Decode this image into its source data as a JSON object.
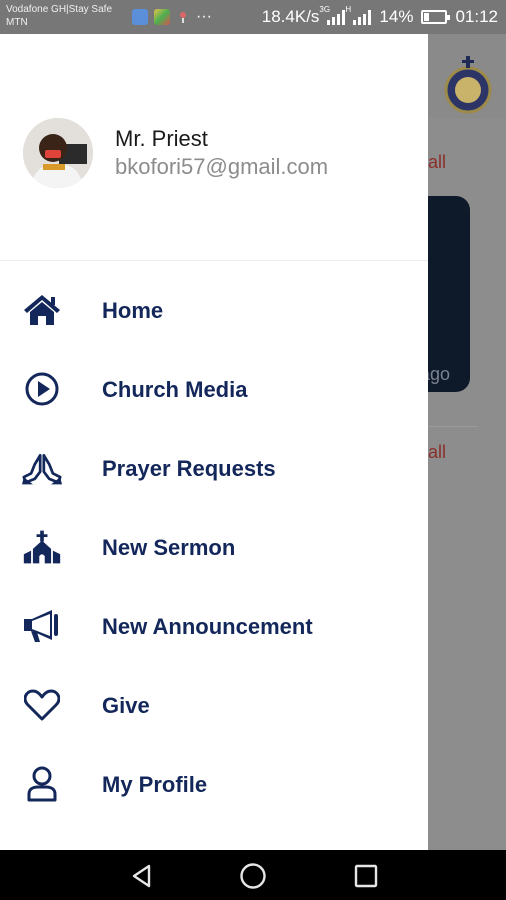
{
  "status_bar": {
    "carrier_line1": "Vodafone GH|Stay Safe",
    "carrier_line2": "MTN",
    "net_speed": "18.4K/s",
    "net_type_1": "3G",
    "net_type_2": "H",
    "battery": "14%",
    "time": "01:12"
  },
  "background_app": {
    "show_all_label": "ow all",
    "card_time": "ago"
  },
  "drawer": {
    "user": {
      "name": "Mr. Priest",
      "email": "bkofori57@gmail.com"
    },
    "menu": [
      {
        "label": "Home",
        "icon": "home-icon"
      },
      {
        "label": "Church Media",
        "icon": "play-circle-icon"
      },
      {
        "label": "Prayer Requests",
        "icon": "praying-hands-icon"
      },
      {
        "label": "New Sermon",
        "icon": "church-icon"
      },
      {
        "label": "New Announcement",
        "icon": "megaphone-icon"
      },
      {
        "label": "Give",
        "icon": "heart-icon"
      },
      {
        "label": "My Profile",
        "icon": "user-icon"
      }
    ]
  },
  "colors": {
    "menu_text": "#13275a",
    "accent_red": "#8a2f2a"
  }
}
